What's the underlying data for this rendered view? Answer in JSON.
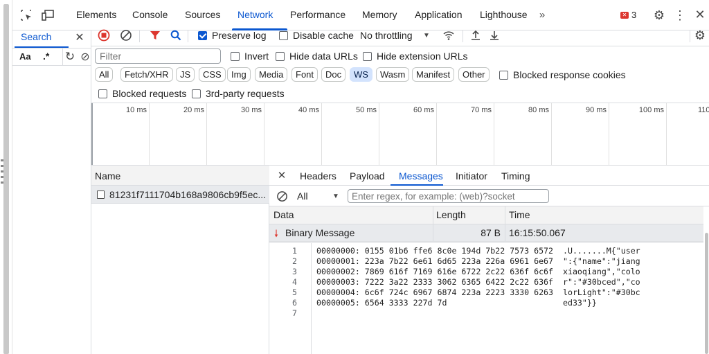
{
  "main_tabs": [
    "Elements",
    "Console",
    "Sources",
    "Network",
    "Performance",
    "Memory",
    "Application",
    "Lighthouse"
  ],
  "issues_count": "3",
  "search_panel": {
    "title": "Search",
    "case_label": "Aa",
    "regex_label": ".*"
  },
  "toolbar": {
    "preserve_log": "Preserve log",
    "disable_cache": "Disable cache",
    "throttling": "No throttling"
  },
  "filter": {
    "placeholder": "Filter",
    "invert": "Invert",
    "hide_data_urls": "Hide data URLs",
    "hide_extension_urls": "Hide extension URLs",
    "types": [
      "All",
      "Fetch/XHR",
      "JS",
      "CSS",
      "Img",
      "Media",
      "Font",
      "Doc",
      "WS",
      "Wasm",
      "Manifest",
      "Other"
    ],
    "active_type": "WS",
    "blocked_response_cookies": "Blocked response cookies",
    "blocked_requests": "Blocked requests",
    "third_party_requests": "3rd-party requests"
  },
  "overview_ticks": [
    "10 ms",
    "20 ms",
    "30 ms",
    "40 ms",
    "50 ms",
    "60 ms",
    "70 ms",
    "80 ms",
    "90 ms",
    "100 ms",
    "110"
  ],
  "requests": {
    "header": "Name",
    "rows": [
      {
        "name": "81231f7111704b168a9806cb9f5ec..."
      }
    ]
  },
  "detail_tabs": [
    "Headers",
    "Payload",
    "Messages",
    "Initiator",
    "Timing"
  ],
  "active_detail_tab": "Messages",
  "messages": {
    "filter_value": "All",
    "regex_placeholder": "Enter regex, for example: (web)?socket",
    "columns": [
      "Data",
      "Length",
      "Time"
    ],
    "rows": [
      {
        "data": "Binary Message",
        "length": "87 B",
        "time": "16:15:50.067"
      }
    ]
  },
  "hex_view": {
    "line_numbers": [
      "1",
      "2",
      "3",
      "4",
      "5",
      "6",
      "7"
    ],
    "lines": [
      "00000000: 0155 01b6 ffe6 8c0e 194d 7b22 7573 6572  .U.......M{\"user",
      "00000001: 223a 7b22 6e61 6d65 223a 226a 6961 6e67  \":{\"name\":\"jiang",
      "00000002: 7869 616f 7169 616e 6722 2c22 636f 6c6f  xiaoqiang\",\"colo",
      "00000003: 7222 3a22 2333 3062 6365 6422 2c22 636f  r\":\"#30bced\",\"co",
      "00000004: 6c6f 724c 6967 6874 223a 2223 3330 6263  lorLight\":\"#30bc",
      "00000005: 6564 3333 227d 7d                        ed33\"}}",
      ""
    ]
  }
}
